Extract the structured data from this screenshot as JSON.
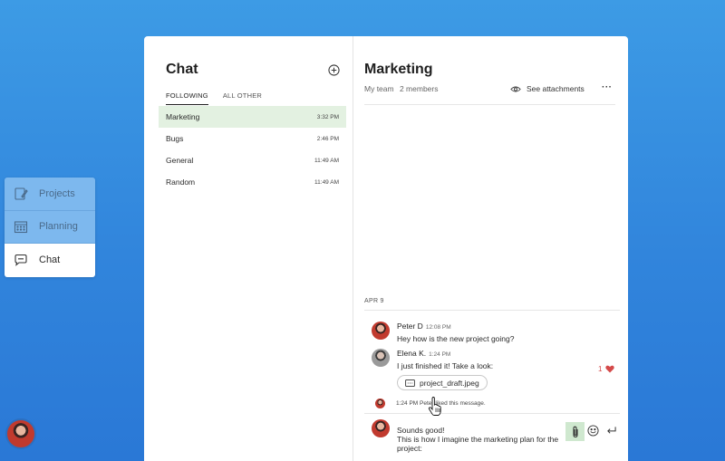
{
  "nav": {
    "items": [
      {
        "label": "Projects",
        "icon": "edit-icon",
        "active": false
      },
      {
        "label": "Planning",
        "icon": "calendar-icon",
        "active": false
      },
      {
        "label": "Chat",
        "icon": "chat-bubble-icon",
        "active": true
      }
    ]
  },
  "chat": {
    "title": "Chat",
    "tabs": [
      {
        "label": "FOLLOWING",
        "active": true
      },
      {
        "label": "ALL OTHER",
        "active": false
      }
    ],
    "channels": [
      {
        "name": "Marketing",
        "time": "3:32 PM",
        "active": true
      },
      {
        "name": "Bugs",
        "time": "2:46 PM",
        "active": false
      },
      {
        "name": "General",
        "time": "11:49 AM",
        "active": false
      },
      {
        "name": "Random",
        "time": "11:49 AM",
        "active": false
      }
    ]
  },
  "conversation": {
    "title": "Marketing",
    "team": "My team",
    "members": "2 members",
    "see_attachments": "See attachments",
    "more": "···",
    "date_label": "APR 9",
    "messages": [
      {
        "author": "Peter D",
        "time": "12:08 PM",
        "text": "Hey how is the new project going?"
      },
      {
        "author": "Elena K.",
        "time": "1:24 PM",
        "text": "I just finished it! Take a look:",
        "attachment": "project_draft.jpeg",
        "likes": "1"
      }
    ],
    "liked_notice": "1:24 PM Peter liked this message.",
    "compose_text_line1": "Sounds good!",
    "compose_text_line2": "This is how I imagine the marketing plan for the project:"
  },
  "colors": {
    "background": "#3185dc",
    "active_channel": "#e3f1e1",
    "attach_highlight": "#cfe8cf",
    "like": "#d44a4a"
  }
}
